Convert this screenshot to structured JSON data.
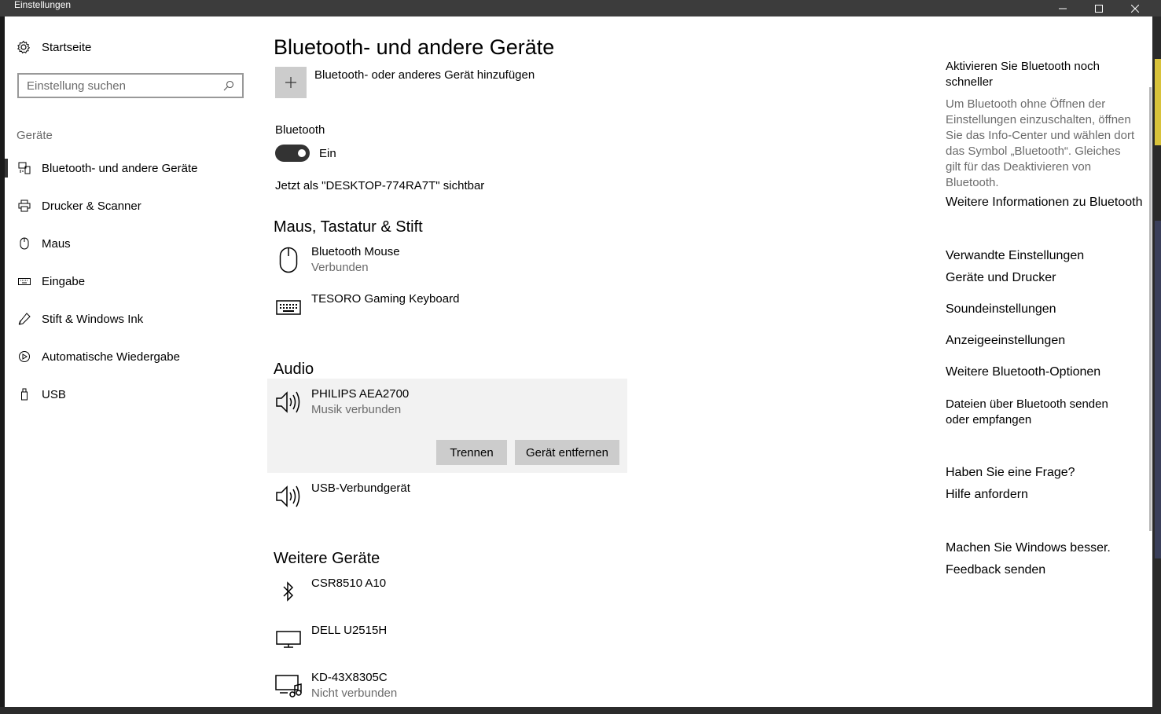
{
  "window": {
    "title": "Einstellungen",
    "controls": [
      "minimize",
      "maximize",
      "close"
    ]
  },
  "sidebar": {
    "home_label": "Startseite",
    "search_placeholder": "Einstellung suchen",
    "section_label": "Geräte",
    "items": [
      {
        "label": "Bluetooth- und andere Geräte",
        "icon": "bluetooth-devices-icon",
        "active": true
      },
      {
        "label": "Drucker & Scanner",
        "icon": "printer-icon"
      },
      {
        "label": "Maus",
        "icon": "mouse-icon"
      },
      {
        "label": "Eingabe",
        "icon": "keyboard-icon"
      },
      {
        "label": "Stift & Windows Ink",
        "icon": "pen-icon"
      },
      {
        "label": "Automatische Wiedergabe",
        "icon": "autoplay-icon"
      },
      {
        "label": "USB",
        "icon": "usb-icon"
      }
    ]
  },
  "main": {
    "title": "Bluetooth- und andere Geräte",
    "add_device_label": "Bluetooth- oder anderes Gerät hinzufügen",
    "bluetooth_label": "Bluetooth",
    "toggle_state": "Ein",
    "visible_as": "Jetzt als \"DESKTOP-774RA7T\" sichtbar",
    "sections": {
      "input": {
        "title": "Maus, Tastatur & Stift",
        "devices": [
          {
            "name": "Bluetooth Mouse",
            "status": "Verbunden",
            "icon": "mouse-icon"
          },
          {
            "name": "TESORO Gaming Keyboard",
            "status": "",
            "icon": "keyboard-icon"
          }
        ]
      },
      "audio": {
        "title": "Audio",
        "devices": [
          {
            "name": "PHILIPS AEA2700",
            "status": "Musik verbunden",
            "icon": "speaker-icon",
            "selected": true
          },
          {
            "name": "USB-Verbundgerät",
            "status": "",
            "icon": "speaker-icon"
          }
        ],
        "disconnect_label": "Trennen",
        "remove_label": "Gerät entfernen"
      },
      "other": {
        "title": "Weitere Geräte",
        "devices": [
          {
            "name": "CSR8510 A10",
            "status": "",
            "icon": "bluetooth-icon"
          },
          {
            "name": "DELL U2515H",
            "status": "",
            "icon": "monitor-icon"
          },
          {
            "name": "KD-43X8305C",
            "status": "Nicht verbunden",
            "icon": "media-device-icon"
          }
        ]
      }
    }
  },
  "side": {
    "tip_title_line1": "Aktivieren Sie Bluetooth noch",
    "tip_title_line2": "schneller",
    "tip_text": [
      "Um Bluetooth ohne Öffnen der",
      "Einstellungen einzuschalten, öffnen",
      "Sie das Info-Center und wählen dort",
      "das Symbol „Bluetooth“. Gleiches",
      "gilt für das Deaktivieren von",
      "Bluetooth."
    ],
    "tip_link": "Weitere Informationen zu Bluetooth",
    "related_title": "Verwandte Einstellungen",
    "related_links": [
      "Geräte und Drucker",
      "Soundeinstellungen",
      "Anzeigeeinstellungen",
      "Weitere Bluetooth-Optionen"
    ],
    "files_link_line1": "Dateien über Bluetooth senden",
    "files_link_line2": "oder empfangen",
    "question_title": "Haben Sie eine Frage?",
    "question_link": "Hilfe anfordern",
    "feedback_title": "Machen Sie Windows besser.",
    "feedback_link": "Feedback senden"
  }
}
